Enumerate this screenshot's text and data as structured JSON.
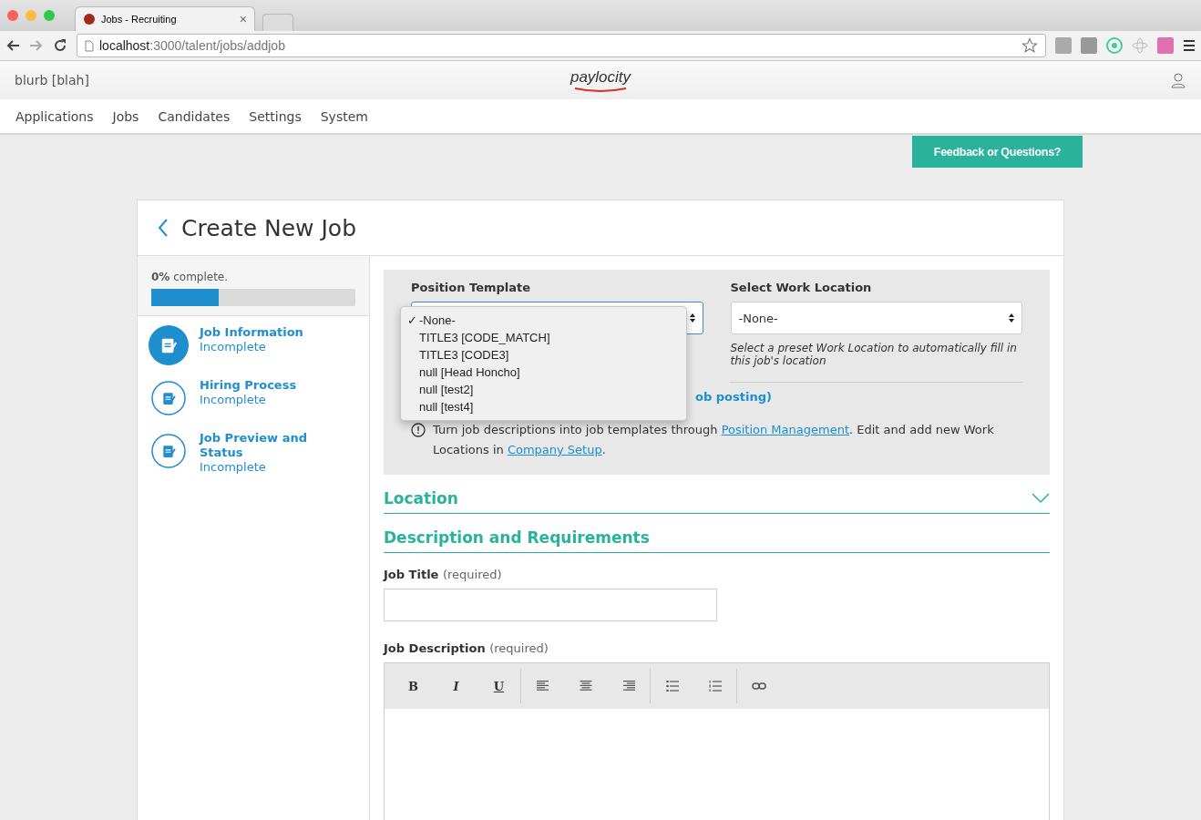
{
  "browser": {
    "tab_title": "Jobs - Recruiting",
    "tab_close": "×",
    "url_host": "localhost",
    "url_path": ":3000/talent/jobs/addjob"
  },
  "header": {
    "user": "blurb [blah]",
    "logo": "paylocity"
  },
  "nav": [
    "Applications",
    "Jobs",
    "Candidates",
    "Settings",
    "System"
  ],
  "feedback_button": "Feedback or Questions?",
  "page_title": "Create New Job",
  "progress": {
    "percent": "0%",
    "label": "complete.",
    "level": 0.33
  },
  "steps": [
    {
      "title": "Job Information",
      "status": "Incomplete",
      "selected": true
    },
    {
      "title": "Hiring Process",
      "status": "Incomplete",
      "selected": false
    },
    {
      "title": "Job Preview and Status",
      "status": "Incomplete",
      "selected": false
    }
  ],
  "template": {
    "label": "Position Template",
    "options": [
      {
        "label": "-None-",
        "selected": true
      },
      {
        "label": "TITLE3 [CODE_MATCH]",
        "selected": false
      },
      {
        "label": "TITLE3 [CODE3]",
        "selected": false
      },
      {
        "label": "null [Head Honcho]",
        "selected": false
      },
      {
        "label": "null [test2]",
        "selected": false
      },
      {
        "label": "null [test4]",
        "selected": false
      }
    ],
    "check": "✓",
    "hidden_link": "ob posting)"
  },
  "work_location": {
    "label": "Select Work Location",
    "value": "-None-",
    "hint": "Select a preset Work Location to automatically fill in this job's location"
  },
  "info": {
    "before": "Turn job descriptions into job templates through ",
    "link1": "Position Management",
    "middle": ". Edit and add new Work Locations in ",
    "link2": "Company Setup",
    "after": "."
  },
  "sections": [
    {
      "title": "Location",
      "expanded": false
    },
    {
      "title": "Description and Requirements"
    }
  ],
  "job_title": {
    "label": "Job Title",
    "note": "(required)"
  },
  "job_description": {
    "label": "Job Description",
    "note": "(required)",
    "format_buttons": [
      "B",
      "I",
      "U"
    ]
  }
}
